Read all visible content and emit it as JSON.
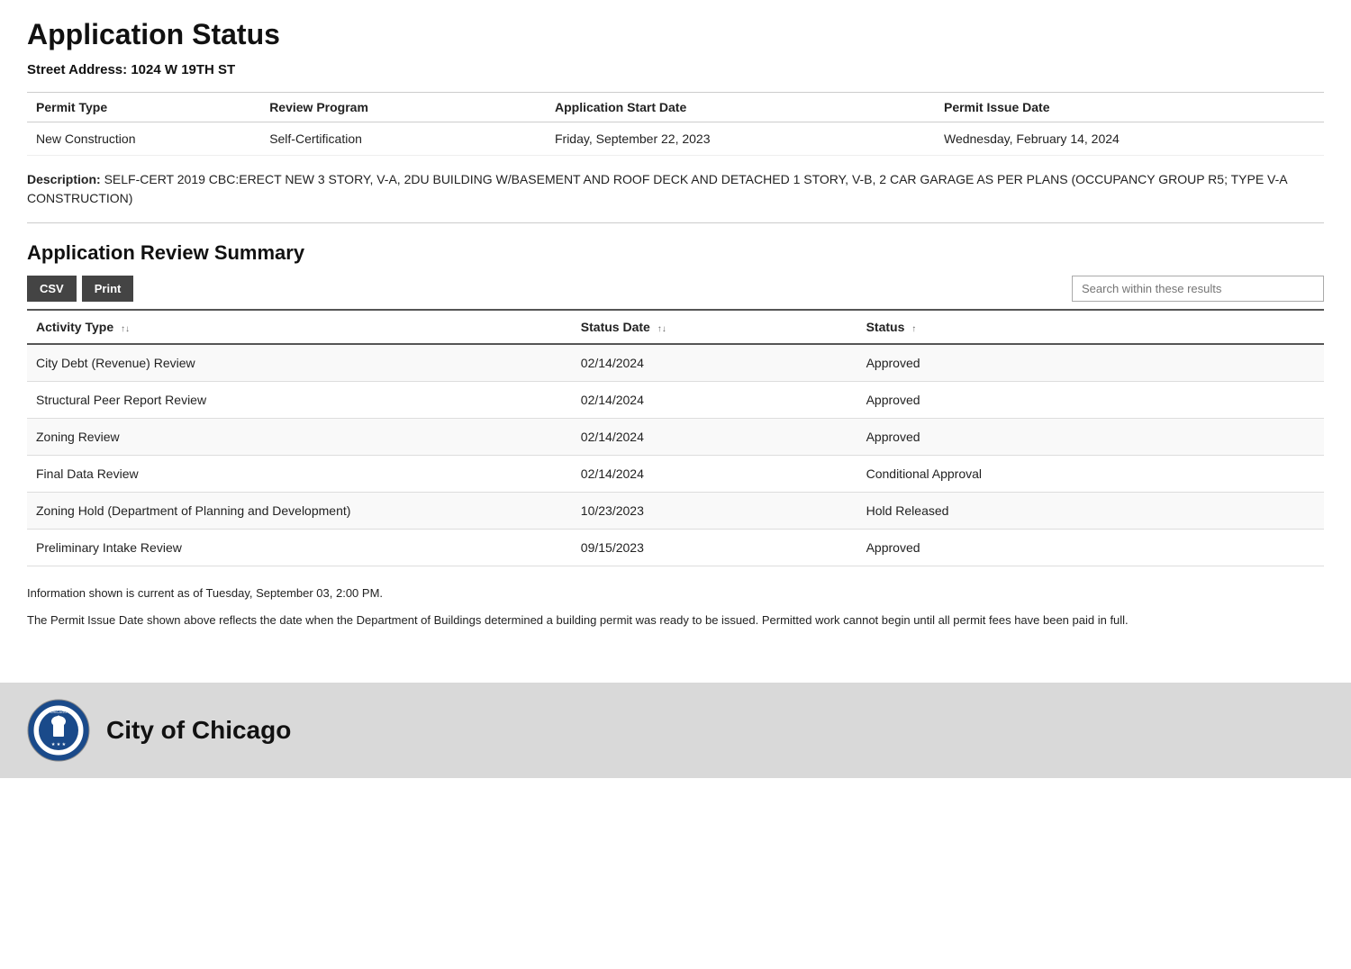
{
  "page": {
    "title": "Application Status",
    "street_address_label": "Street Address:",
    "street_address_value": "1024 W 19TH ST"
  },
  "permit_table": {
    "headers": [
      "Permit Type",
      "Review Program",
      "Application Start Date",
      "Permit Issue Date"
    ],
    "row": {
      "permit_type": "New Construction",
      "review_program": "Self-Certification",
      "app_start_date": "Friday, September 22, 2023",
      "permit_issue_date": "Wednesday, February 14, 2024"
    }
  },
  "description": {
    "label": "Description:",
    "text": "SELF-CERT 2019 CBC:ERECT NEW 3 STORY, V-A, 2DU BUILDING W/BASEMENT AND ROOF DECK AND DETACHED 1 STORY, V-B, 2 CAR GARAGE AS PER PLANS (OCCUPANCY GROUP R5; TYPE V-A CONSTRUCTION)"
  },
  "review_summary": {
    "section_title": "Application Review Summary",
    "csv_button": "CSV",
    "print_button": "Print",
    "search_placeholder": "Search within these results",
    "table_headers": {
      "activity_type": "Activity Type",
      "status_date": "Status Date",
      "status": "Status"
    },
    "rows": [
      {
        "activity_type": "City Debt (Revenue) Review",
        "status_date": "02/14/2024",
        "status": "Approved"
      },
      {
        "activity_type": "Structural Peer Report Review",
        "status_date": "02/14/2024",
        "status": "Approved"
      },
      {
        "activity_type": "Zoning Review",
        "status_date": "02/14/2024",
        "status": "Approved"
      },
      {
        "activity_type": "Final Data Review",
        "status_date": "02/14/2024",
        "status": "Conditional Approval"
      },
      {
        "activity_type": "Zoning Hold (Department of Planning and Development)",
        "status_date": "10/23/2023",
        "status": "Hold Released"
      },
      {
        "activity_type": "Preliminary Intake Review",
        "status_date": "09/15/2023",
        "status": "Approved"
      }
    ]
  },
  "info_lines": {
    "line1": "Information shown is current as of Tuesday, September 03, 2:00 PM.",
    "line2": "The Permit Issue Date shown above reflects the date when the Department of Buildings determined a building permit was ready to be issued. Permitted work cannot begin until all permit fees have been paid in full."
  },
  "footer": {
    "city_name": "City of Chicago"
  }
}
